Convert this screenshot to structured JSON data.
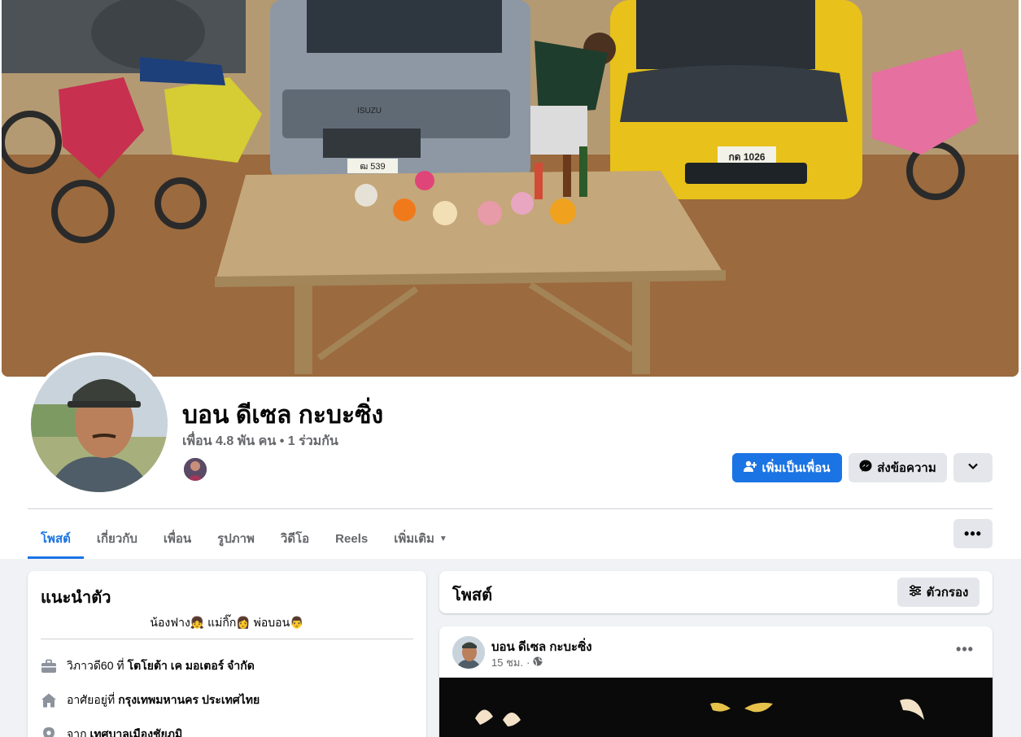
{
  "profile": {
    "name": "บอน ดีเซล กะบะซิ่ง",
    "friends_line": "เพื่อน 4.8 พัน คน • 1 ร่วมกัน"
  },
  "actions": {
    "add_friend_label": "เพิ่มเป็นเพื่อน",
    "message_label": "ส่งข้อความ"
  },
  "tabs": [
    {
      "label": "โพสต์",
      "active": true
    },
    {
      "label": "เกี่ยวกับ",
      "active": false
    },
    {
      "label": "เพื่อน",
      "active": false
    },
    {
      "label": "รูปภาพ",
      "active": false
    },
    {
      "label": "วิดีโอ",
      "active": false
    },
    {
      "label": "Reels",
      "active": false
    },
    {
      "label": "เพิ่มเติม",
      "active": false
    }
  ],
  "intro": {
    "title": "แนะนำตัว",
    "bio": "น้องฟาง👧 แม่กิ๊ก👩 พ่อบอน👨",
    "work_prefix": "วิภาวดี60 ที่",
    "work_place": "โตโยต้า เค มอเตอร์ จำกัด",
    "lives_prefix": "อาศัยอยู่ที่",
    "lives_place": "กรุงเทพมหานคร ประเทศไทย",
    "from_prefix": "จาก",
    "from_place": "เทศบาลเมืองชัยภูมิ"
  },
  "posts": {
    "title": "โพสต์",
    "filter_label": "ตัวกรอง"
  },
  "post": {
    "author": "บอน ดีเซล กะบะซิ่ง",
    "time": "15 ชม.",
    "separator": "·"
  },
  "colors": {
    "accent": "#1b74e4",
    "secondary_button": "#e4e6eb",
    "feed_background": "#f0f2f5"
  },
  "cover_plates": {
    "car_plate": "กด 1026",
    "truck_plate": "ฒ 539",
    "truck_badge": "ISUZU"
  }
}
